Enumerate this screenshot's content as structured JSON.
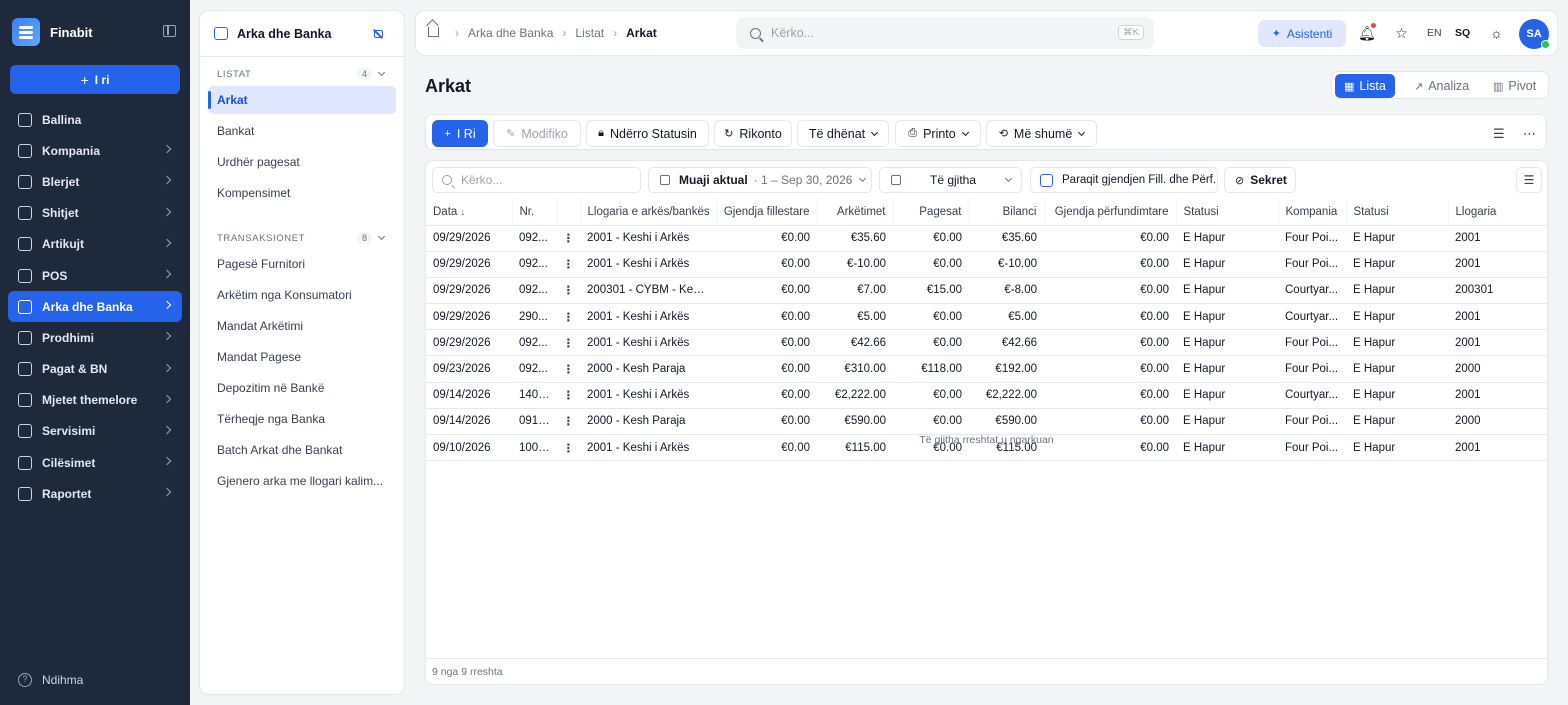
{
  "app": {
    "name": "Finabit"
  },
  "sidebar": {
    "new_label": "I ri",
    "items": [
      {
        "label": "Ballina",
        "icon": "home-grid-icon",
        "chevron": false,
        "active": false
      },
      {
        "label": "Kompania",
        "icon": "building-icon",
        "chevron": true,
        "active": false
      },
      {
        "label": "Blerjet",
        "icon": "truck-icon",
        "chevron": true,
        "active": false
      },
      {
        "label": "Shitjet",
        "icon": "cart-icon",
        "chevron": true,
        "active": false
      },
      {
        "label": "Artikujt",
        "icon": "box-icon",
        "chevron": true,
        "active": false
      },
      {
        "label": "POS",
        "icon": "register-icon",
        "chevron": true,
        "active": false
      },
      {
        "label": "Arka dhe Banka",
        "icon": "wallet-icon",
        "chevron": true,
        "active": true
      },
      {
        "label": "Prodhimi",
        "icon": "factory-icon",
        "chevron": true,
        "active": false
      },
      {
        "label": "Pagat & BN",
        "icon": "coins-icon",
        "chevron": true,
        "active": false
      },
      {
        "label": "Mjetet themelore",
        "icon": "asset-icon",
        "chevron": true,
        "active": false
      },
      {
        "label": "Servisimi",
        "icon": "wrench-icon",
        "chevron": true,
        "active": false
      },
      {
        "label": "Cilësimet",
        "icon": "gear-icon",
        "chevron": true,
        "active": false
      },
      {
        "label": "Raportet",
        "icon": "chart-icon",
        "chevron": true,
        "active": false
      }
    ],
    "help_label": "Ndihma"
  },
  "subpanel": {
    "title": "Arka dhe Banka",
    "sections": [
      {
        "label": "LISTAT",
        "count": "4",
        "items": [
          "Arkat",
          "Bankat",
          "Urdhër pagesat",
          "Kompensimet"
        ]
      },
      {
        "label": "TRANSAKSIONET",
        "count": "8",
        "items": [
          "Pagesë Furnitori",
          "Arkëtim nga Konsumatori",
          "Mandat Arkëtimi",
          "Mandat Pagese",
          "Depozitim në Bankë",
          "Tërheqje nga Banka",
          "Batch Arkat dhe Bankat",
          "Gjenero arka me llogari kalim..."
        ]
      }
    ]
  },
  "topbar": {
    "breadcrumb": [
      "Arka dhe Banka",
      "Listat",
      "Arkat"
    ],
    "search_placeholder": "Kërko...",
    "shortcut": "⌘K",
    "assistant_label": "Asistenti",
    "lang_en": "EN",
    "lang_sq": "SQ",
    "avatar_initials": "SA"
  },
  "page": {
    "title": "Arkat",
    "views": [
      "Lista",
      "Analiza",
      "Pivot"
    ]
  },
  "toolbar": {
    "new": "I Ri",
    "edit": "Modifiko",
    "status": "Ndërro Statusin",
    "refresh": "Rikonto",
    "data": "Të dhënat",
    "print": "Printo",
    "more": "Më shumë"
  },
  "filters": {
    "search_placeholder": "Kërko...",
    "period_label": "Muaji aktual",
    "period_range": "· 1 – Sep 30, 2026",
    "all_label": "Të gjitha",
    "show_balance_label": "Paraqit gjendjen Fill. dhe Përf.",
    "secret_label": "Sekret"
  },
  "table": {
    "columns": [
      "Data",
      "Nr.",
      "",
      "Llogaria e arkës/bankës",
      "Gjendja fillestare",
      "Arkëtimet",
      "Pagesat",
      "Bilanci",
      "Gjendja përfundimtare",
      "Statusi",
      "Kompania",
      "Statusi",
      "Llogaria"
    ],
    "rows": [
      [
        "09/29/2026",
        "092...",
        "2001 - Keshi i Arkës",
        "€0.00",
        "€35.60",
        "€0.00",
        "€35.60",
        "€0.00",
        "E Hapur",
        "Four Poi...",
        "E Hapur",
        "2001"
      ],
      [
        "09/29/2026",
        "092...",
        "2001 - Keshi i Arkës",
        "€0.00",
        "€-10.00",
        "€0.00",
        "€-10.00",
        "€0.00",
        "E Hapur",
        "Four Poi...",
        "E Hapur",
        "2001"
      ],
      [
        "09/29/2026",
        "092...",
        "200301 - CYBM - Kesh...",
        "€0.00",
        "€7.00",
        "€15.00",
        "€-8.00",
        "€0.00",
        "E Hapur",
        "Courtyar...",
        "E Hapur",
        "200301"
      ],
      [
        "09/29/2026",
        "290...",
        "2001 - Keshi i Arkës",
        "€0.00",
        "€5.00",
        "€0.00",
        "€5.00",
        "€0.00",
        "E Hapur",
        "Courtyar...",
        "E Hapur",
        "2001"
      ],
      [
        "09/29/2026",
        "092...",
        "2001 - Keshi i Arkës",
        "€0.00",
        "€42.66",
        "€0.00",
        "€42.66",
        "€0.00",
        "E Hapur",
        "Four Poi...",
        "E Hapur",
        "2001"
      ],
      [
        "09/23/2026",
        "092...",
        "2000 - Kesh Paraja",
        "€0.00",
        "€310.00",
        "€118.00",
        "€192.00",
        "€0.00",
        "E Hapur",
        "Four Poi...",
        "E Hapur",
        "2000"
      ],
      [
        "09/14/2026",
        "1409...",
        "2001 - Keshi i Arkës",
        "€0.00",
        "€2,222.00",
        "€0.00",
        "€2,222.00",
        "€0.00",
        "E Hapur",
        "Courtyar...",
        "E Hapur",
        "2001"
      ],
      [
        "09/14/2026",
        "0914...",
        "2000 - Kesh Paraja",
        "€0.00",
        "€590.00",
        "€0.00",
        "€590.00",
        "€0.00",
        "E Hapur",
        "Four Poi...",
        "E Hapur",
        "2000"
      ],
      [
        "09/10/2026",
        "1009...",
        "2001 - Keshi i Arkës",
        "€0.00",
        "€115.00",
        "€0.00",
        "€115.00",
        "€0.00",
        "E Hapur",
        "Four Poi...",
        "E Hapur",
        "2001"
      ]
    ],
    "all_loaded": "Të gjitha rreshtat u ngarkuan",
    "footer": "9 nga 9 rreshta"
  }
}
